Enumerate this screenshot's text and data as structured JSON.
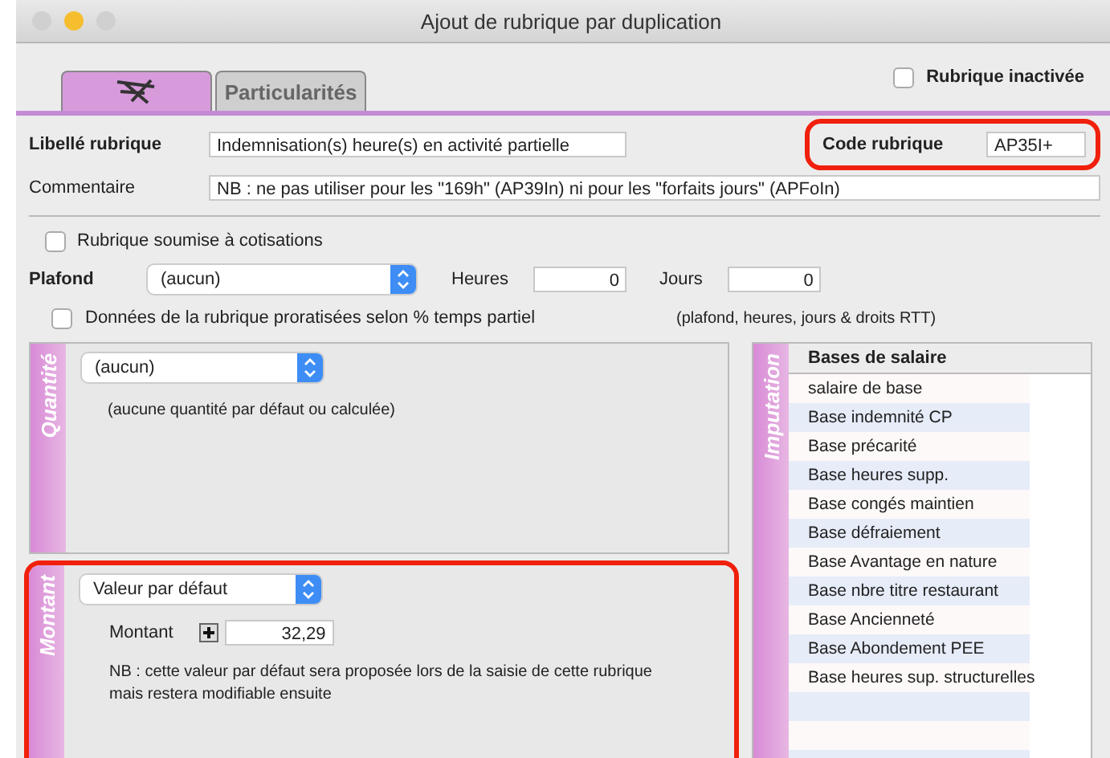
{
  "window": {
    "title": "Ajout de rubrique par duplication"
  },
  "tabs": [
    {
      "kind": "icon",
      "selected": true
    },
    {
      "kind": "text",
      "label": "Particularités",
      "selected": false
    }
  ],
  "inactive_checkbox": {
    "label": "Rubrique inactivée",
    "checked": false
  },
  "libelle": {
    "label": "Libellé rubrique",
    "value": "Indemnisation(s) heure(s) en activité partielle"
  },
  "code": {
    "label": "Code rubrique",
    "value": "AP35I+",
    "highlighted": true
  },
  "commentaire": {
    "label": "Commentaire",
    "value": "NB : ne pas utiliser pour les \"169h\" (AP39In) ni pour les \"forfaits jours\" (APFoIn)"
  },
  "cotisations_checkbox": {
    "label": "Rubrique soumise à cotisations",
    "checked": false
  },
  "plafond": {
    "label": "Plafond",
    "value": "(aucun)",
    "heures_label": "Heures",
    "heures": "0",
    "jours_label": "Jours",
    "jours": "0"
  },
  "prorata_checkbox": {
    "label": "Données de la rubrique proratisées selon % temps partiel",
    "checked": false,
    "note": "(plafond, heures, jours & droits RTT)"
  },
  "quantite": {
    "side_label": "Quantité",
    "select": "(aucun)",
    "note": "(aucune quantité par défaut ou calculée)"
  },
  "montant": {
    "side_label": "Montant",
    "select": "Valeur par défaut",
    "field_label": "Montant",
    "value": "32,29",
    "note": "NB : cette valeur par défaut sera proposée lors de la saisie de cette rubrique mais restera modifiable ensuite",
    "highlighted": true
  },
  "imputation": {
    "side_label": "Imputation",
    "header": "Bases de salaire",
    "items": [
      "salaire de base",
      "Base indemnité CP",
      "Base précarité",
      "Base heures supp.",
      "Base congés maintien",
      "Base défraiement",
      "Base Avantage en nature",
      "Base nbre titre restaurant",
      "Base Ancienneté",
      "Base Abondement PEE",
      "Base heures sup. structurelles"
    ]
  }
}
